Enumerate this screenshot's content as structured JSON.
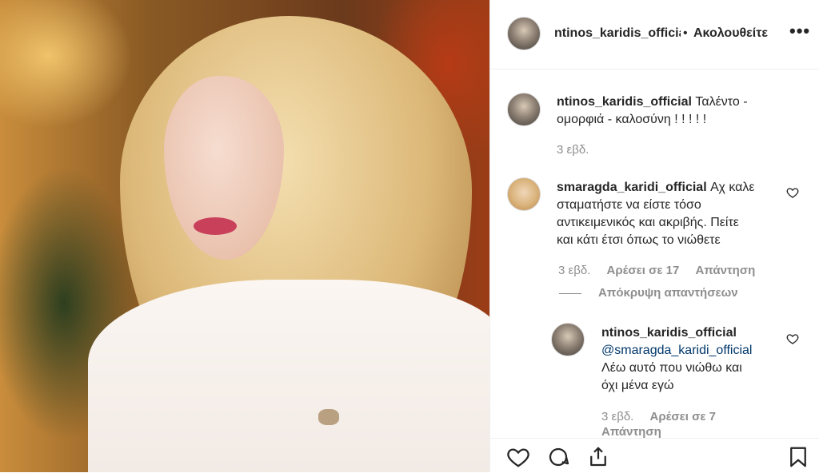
{
  "post": {
    "author": "ntinos_karidis_official",
    "separator": "•",
    "follow_label": "Ακολουθείτε",
    "more_label": "•••"
  },
  "comments": [
    {
      "username": "ntinos_karidis_official",
      "line1": "Ταλέντο -",
      "line2": "ομορφιά - καλοσύνη ! ! ! ! !",
      "time": "3 εβδ."
    },
    {
      "username": "smaragda_karidi_official",
      "line1": "Αχ καλε",
      "line2": "σταματήστε να είστε τόσο",
      "line3": "αντικειμενικός και ακριβής. Πείτε",
      "line4": "και κάτι έτσι όπως το νιώθετε",
      "time": "3 εβδ.",
      "likes": "Αρέσει σε 17",
      "reply": "Απάντηση",
      "hide_replies": "Απόκρυψη απαντήσεων"
    },
    {
      "username": "ntinos_karidis_official",
      "mention": "@smaragda_karidi_official",
      "line1": "Λέω αυτό που νιώθω και",
      "line2": "όχι μένα εγώ",
      "time": "3 εβδ.",
      "likes": "Αρέσει σε 7",
      "reply": "Απάντηση"
    }
  ],
  "icons": [
    "heart-icon",
    "comment-icon",
    "share-icon",
    "bookmark-icon",
    "more-icon"
  ]
}
